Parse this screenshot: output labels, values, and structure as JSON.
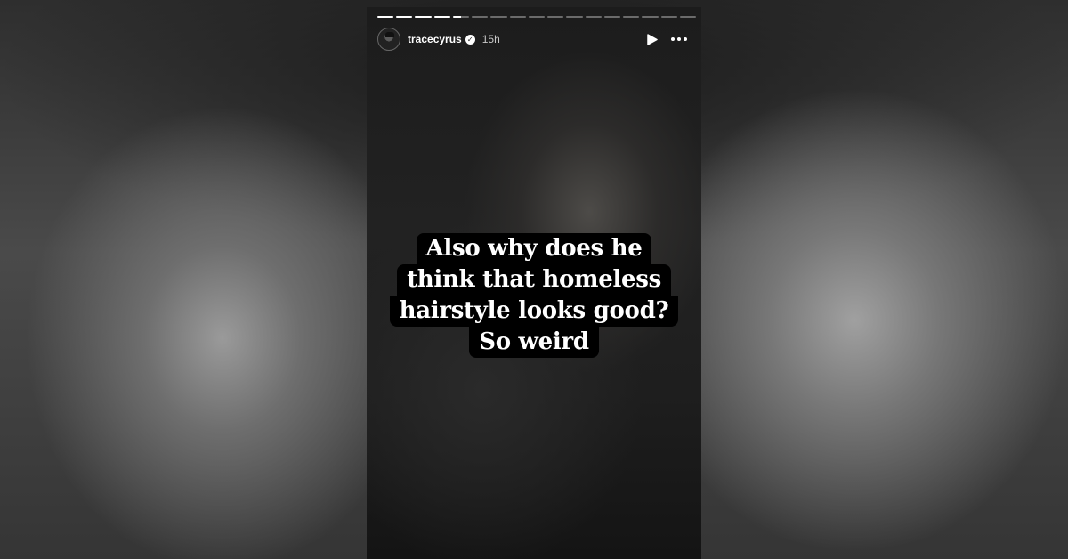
{
  "story": {
    "progress": {
      "total_segments": 17,
      "completed_segments": 4,
      "current_segment_fraction": 0.5
    },
    "header": {
      "username": "tracecyrus",
      "verified": true,
      "time_ago": "15h",
      "play_icon": "play-icon",
      "more_icon": "more-options-icon"
    },
    "caption": {
      "lines": [
        "Also why does he",
        "think that homeless",
        "hairstyle looks good?",
        "So weird"
      ]
    }
  },
  "colors": {
    "text": "#ffffff",
    "caption_bg": "#000000",
    "time": "#c8c8c8"
  }
}
